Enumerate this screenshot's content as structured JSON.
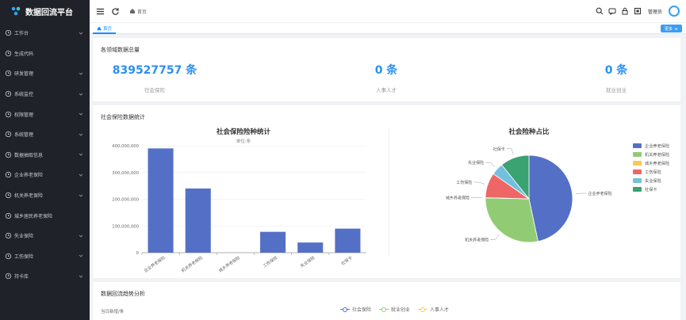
{
  "app": {
    "title": "数据回流平台"
  },
  "sidebar": {
    "items": [
      {
        "label": "工作台",
        "has_children": true
      },
      {
        "label": "生成代码",
        "has_children": false
      },
      {
        "label": "研发管理",
        "has_children": true
      },
      {
        "label": "系统监控",
        "has_children": true
      },
      {
        "label": "权限管理",
        "has_children": true
      },
      {
        "label": "系统管理",
        "has_children": true
      },
      {
        "label": "数据抽取信息",
        "has_children": true
      },
      {
        "label": "企业养老保险",
        "has_children": true
      },
      {
        "label": "机关养老保险",
        "has_children": true
      },
      {
        "label": "城乡居民养老保险",
        "has_children": false
      },
      {
        "label": "失业保险",
        "has_children": true
      },
      {
        "label": "工伤保险",
        "has_children": true
      },
      {
        "label": "持卡库",
        "has_children": true
      }
    ]
  },
  "topbar": {
    "breadcrumb": "首页",
    "user": "管理员"
  },
  "tabs": {
    "items": [
      {
        "label": "首页"
      }
    ],
    "more_label": "更多"
  },
  "overview": {
    "title": "各领域数据总量",
    "stats": [
      {
        "value": "839527757 条",
        "label": "社会保险"
      },
      {
        "value": "0 条",
        "label": "人事人才"
      },
      {
        "value": "0 条",
        "label": "就业创业"
      }
    ]
  },
  "social": {
    "title": "社会保险数据统计"
  },
  "trend": {
    "title": "数据回流趋势分析",
    "ylabel": "当日新增/条",
    "legend": [
      {
        "name": "社会保险",
        "color": "#5470c6"
      },
      {
        "name": "就业创业",
        "color": "#91cc75"
      },
      {
        "name": "人事人才",
        "color": "#fac858"
      }
    ]
  },
  "chart_data": [
    {
      "type": "bar",
      "title": "社会保险险种统计",
      "subtitle": "单位:条",
      "categories": [
        "企业养老保险",
        "机关养老保险",
        "城乡养老保险",
        "工伤保险",
        "失业保险",
        "社保卡"
      ],
      "values": [
        390000000,
        240000000,
        0,
        78000000,
        38000000,
        90000000
      ],
      "ylim": [
        0,
        400000000
      ],
      "yticks": [
        "0",
        "100,000,000",
        "200,000,000",
        "300,000,000",
        "400,000,000"
      ],
      "color": "#5470c6",
      "grid": true
    },
    {
      "type": "pie",
      "title": "社会险种占比",
      "labels": [
        "企业养老保险",
        "机关养老保险",
        "城乡养老保险",
        "工伤保险",
        "失业保险",
        "社保卡"
      ],
      "values": [
        46.5,
        28.6,
        0.05,
        9.3,
        4.5,
        10.7
      ],
      "colors": [
        "#5470c6",
        "#91cc75",
        "#fac858",
        "#ee6666",
        "#73c0de",
        "#3ba272"
      ],
      "legend_position": "right"
    }
  ]
}
